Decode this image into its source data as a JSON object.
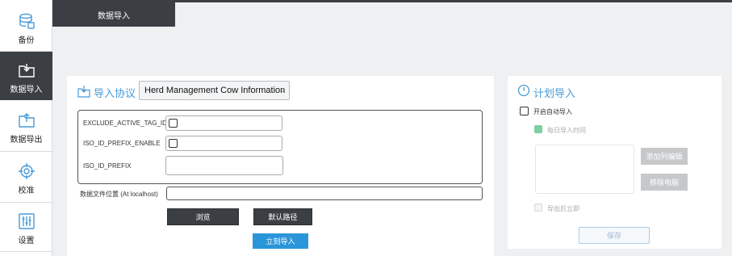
{
  "sidebar": {
    "items": [
      {
        "label": "备份",
        "icon": "database-icon"
      },
      {
        "label": "数据导入",
        "icon": "folder-import-icon"
      },
      {
        "label": "数据导出",
        "icon": "folder-export-icon"
      },
      {
        "label": "校准",
        "icon": "crosshair-icon"
      },
      {
        "label": "设置",
        "icon": "sliders-icon"
      }
    ],
    "active_index": 1
  },
  "tabs": [
    {
      "label": "数据导入"
    }
  ],
  "import": {
    "title": "导入协议",
    "protocol_selected": "Herd Management Cow Information",
    "params": [
      {
        "label": "EXCLUDE_ACTIVE_TAG_ID",
        "checked": false
      },
      {
        "label": "ISO_ID_PREFIX_ENABLE",
        "checked": false
      },
      {
        "label": "ISO_ID_PREFIX",
        "value": ""
      }
    ],
    "path_label": "数据文件位置 (At localhost)",
    "path_value": "",
    "browse_label": "浏览",
    "default_path_label": "默认路径",
    "import_now_label": "立刻导入"
  },
  "schedule": {
    "title": "计划导入",
    "enable_auto_label": "开启自动导入",
    "daily_time_label": "每日导入时间",
    "add_button": "添加列编辑",
    "remove_button": "移除电脑",
    "after_export_label": "导出后立即",
    "save_button": "保存"
  },
  "colors": {
    "accent": "#4a9ad6",
    "sidebar_active": "#3b3f44",
    "primary_button": "#2b95d9",
    "daily_checkbox": "#7dcea0"
  }
}
